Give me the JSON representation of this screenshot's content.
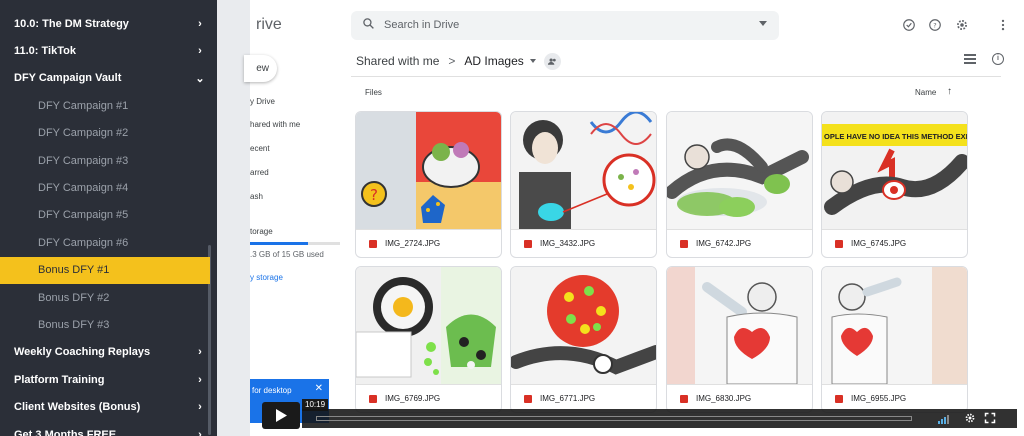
{
  "sidebar": {
    "items": [
      {
        "label": "10.0: The DM Strategy",
        "chevron": "›",
        "type": "section"
      },
      {
        "label": "11.0: TikTok",
        "chevron": "›",
        "type": "section"
      },
      {
        "label": "DFY Campaign Vault",
        "chevron": "⌄",
        "type": "section"
      },
      {
        "label": "DFY Campaign #1",
        "type": "sub"
      },
      {
        "label": "DFY Campaign #2",
        "type": "sub"
      },
      {
        "label": "DFY Campaign #3",
        "type": "sub"
      },
      {
        "label": "DFY Campaign #4",
        "type": "sub"
      },
      {
        "label": "DFY Campaign #5",
        "type": "sub"
      },
      {
        "label": "DFY Campaign #6",
        "type": "sub"
      },
      {
        "label": "Bonus DFY #1",
        "type": "sub",
        "active": true
      },
      {
        "label": "Bonus DFY #2",
        "type": "sub"
      },
      {
        "label": "Bonus DFY #3",
        "type": "sub"
      },
      {
        "label": "Weekly Coaching Replays",
        "chevron": "›",
        "type": "section"
      },
      {
        "label": "Platform Training",
        "chevron": "›",
        "type": "section"
      },
      {
        "label": "Client Websites (Bonus)",
        "chevron": "›",
        "type": "section"
      },
      {
        "label": "Get 3 Months FREE",
        "chevron": "›",
        "type": "section"
      }
    ],
    "active_color": "#f4c11c"
  },
  "drive": {
    "title": "rive",
    "search_placeholder": "Search in Drive",
    "new_label": "ew",
    "nav": [
      "y Drive",
      "hared with me",
      "ecent",
      "arred",
      "ash",
      "torage"
    ],
    "storage_used": ".3 GB of 15 GB used",
    "buy_storage": "y storage",
    "desktop_popup": "for desktop",
    "breadcrumb": {
      "parent": "Shared with me",
      "separator": ">",
      "current": "AD Images"
    },
    "files_label": "Files",
    "sort_label": "Name",
    "sort_arrow": "↑",
    "files": [
      {
        "name": "IMG_2724.JPG"
      },
      {
        "name": "IMG_3432.JPG"
      },
      {
        "name": "IMG_6742.JPG"
      },
      {
        "name": "IMG_6745.JPG",
        "banner": "OPLE HAVE NO IDEA THIS METHOD EXISTS"
      },
      {
        "name": "IMG_6769.JPG"
      },
      {
        "name": "IMG_6771.JPG"
      },
      {
        "name": "IMG_6830.JPG"
      },
      {
        "name": "IMG_6955.JPG"
      }
    ]
  },
  "player": {
    "current_time": "10:19",
    "play_icon": "play-icon",
    "settings_icon": "gear-icon",
    "fullscreen_icon": "fullscreen-icon"
  }
}
